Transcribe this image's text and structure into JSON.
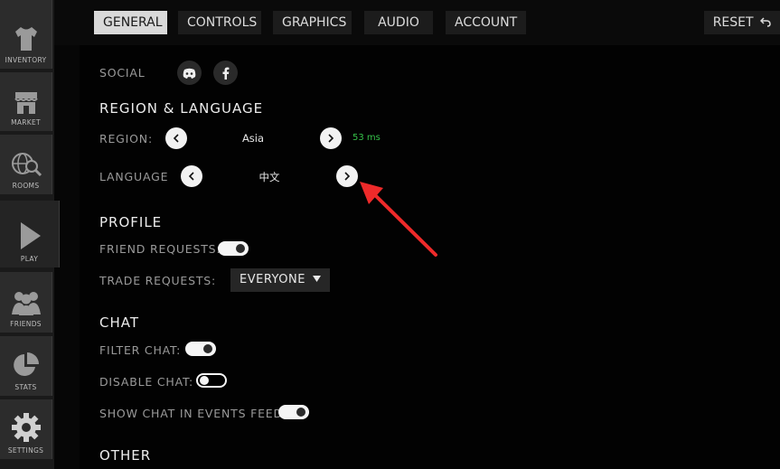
{
  "sidebar": {
    "items": [
      {
        "label": "INVENTORY",
        "icon": "shirt-icon"
      },
      {
        "label": "MARKET",
        "icon": "store-icon"
      },
      {
        "label": "ROOMS",
        "icon": "globe-search-icon"
      },
      {
        "label": "PLAY",
        "icon": "play-icon"
      },
      {
        "label": "FRIENDS",
        "icon": "people-icon"
      },
      {
        "label": "STATS",
        "icon": "pie-chart-icon"
      },
      {
        "label": "SETTINGS",
        "icon": "gear-icon"
      }
    ]
  },
  "tabs": [
    {
      "label": "GENERAL",
      "active": true
    },
    {
      "label": "CONTROLS",
      "active": false
    },
    {
      "label": "GRAPHICS",
      "active": false
    },
    {
      "label": "AUDIO",
      "active": false
    },
    {
      "label": "ACCOUNT",
      "active": false
    }
  ],
  "reset_label": "RESET",
  "social": {
    "label": "SOCIAL",
    "icons": [
      "discord-icon",
      "facebook-icon"
    ]
  },
  "region_language": {
    "title": "REGION & LANGUAGE",
    "region_label": "REGION:",
    "region_value": "Asia",
    "ping": "53 ms",
    "language_label": "LANGUAGE",
    "language_value": "中文"
  },
  "profile": {
    "title": "PROFILE",
    "friend_requests_label": "FRIEND REQUESTS:",
    "friend_requests_on": true,
    "trade_requests_label": "TRADE REQUESTS:",
    "trade_requests_value": "EVERYONE"
  },
  "chat": {
    "title": "CHAT",
    "filter_label": "FILTER CHAT:",
    "filter_on": true,
    "disable_label": "DISABLE CHAT:",
    "disable_on": false,
    "events_feed_label": "SHOW CHAT IN EVENTS FEED:",
    "events_feed_on": true
  },
  "other": {
    "title": "OTHER"
  },
  "colors": {
    "ping": "#36c24a",
    "annotation_arrow": "#ee2a2a"
  }
}
